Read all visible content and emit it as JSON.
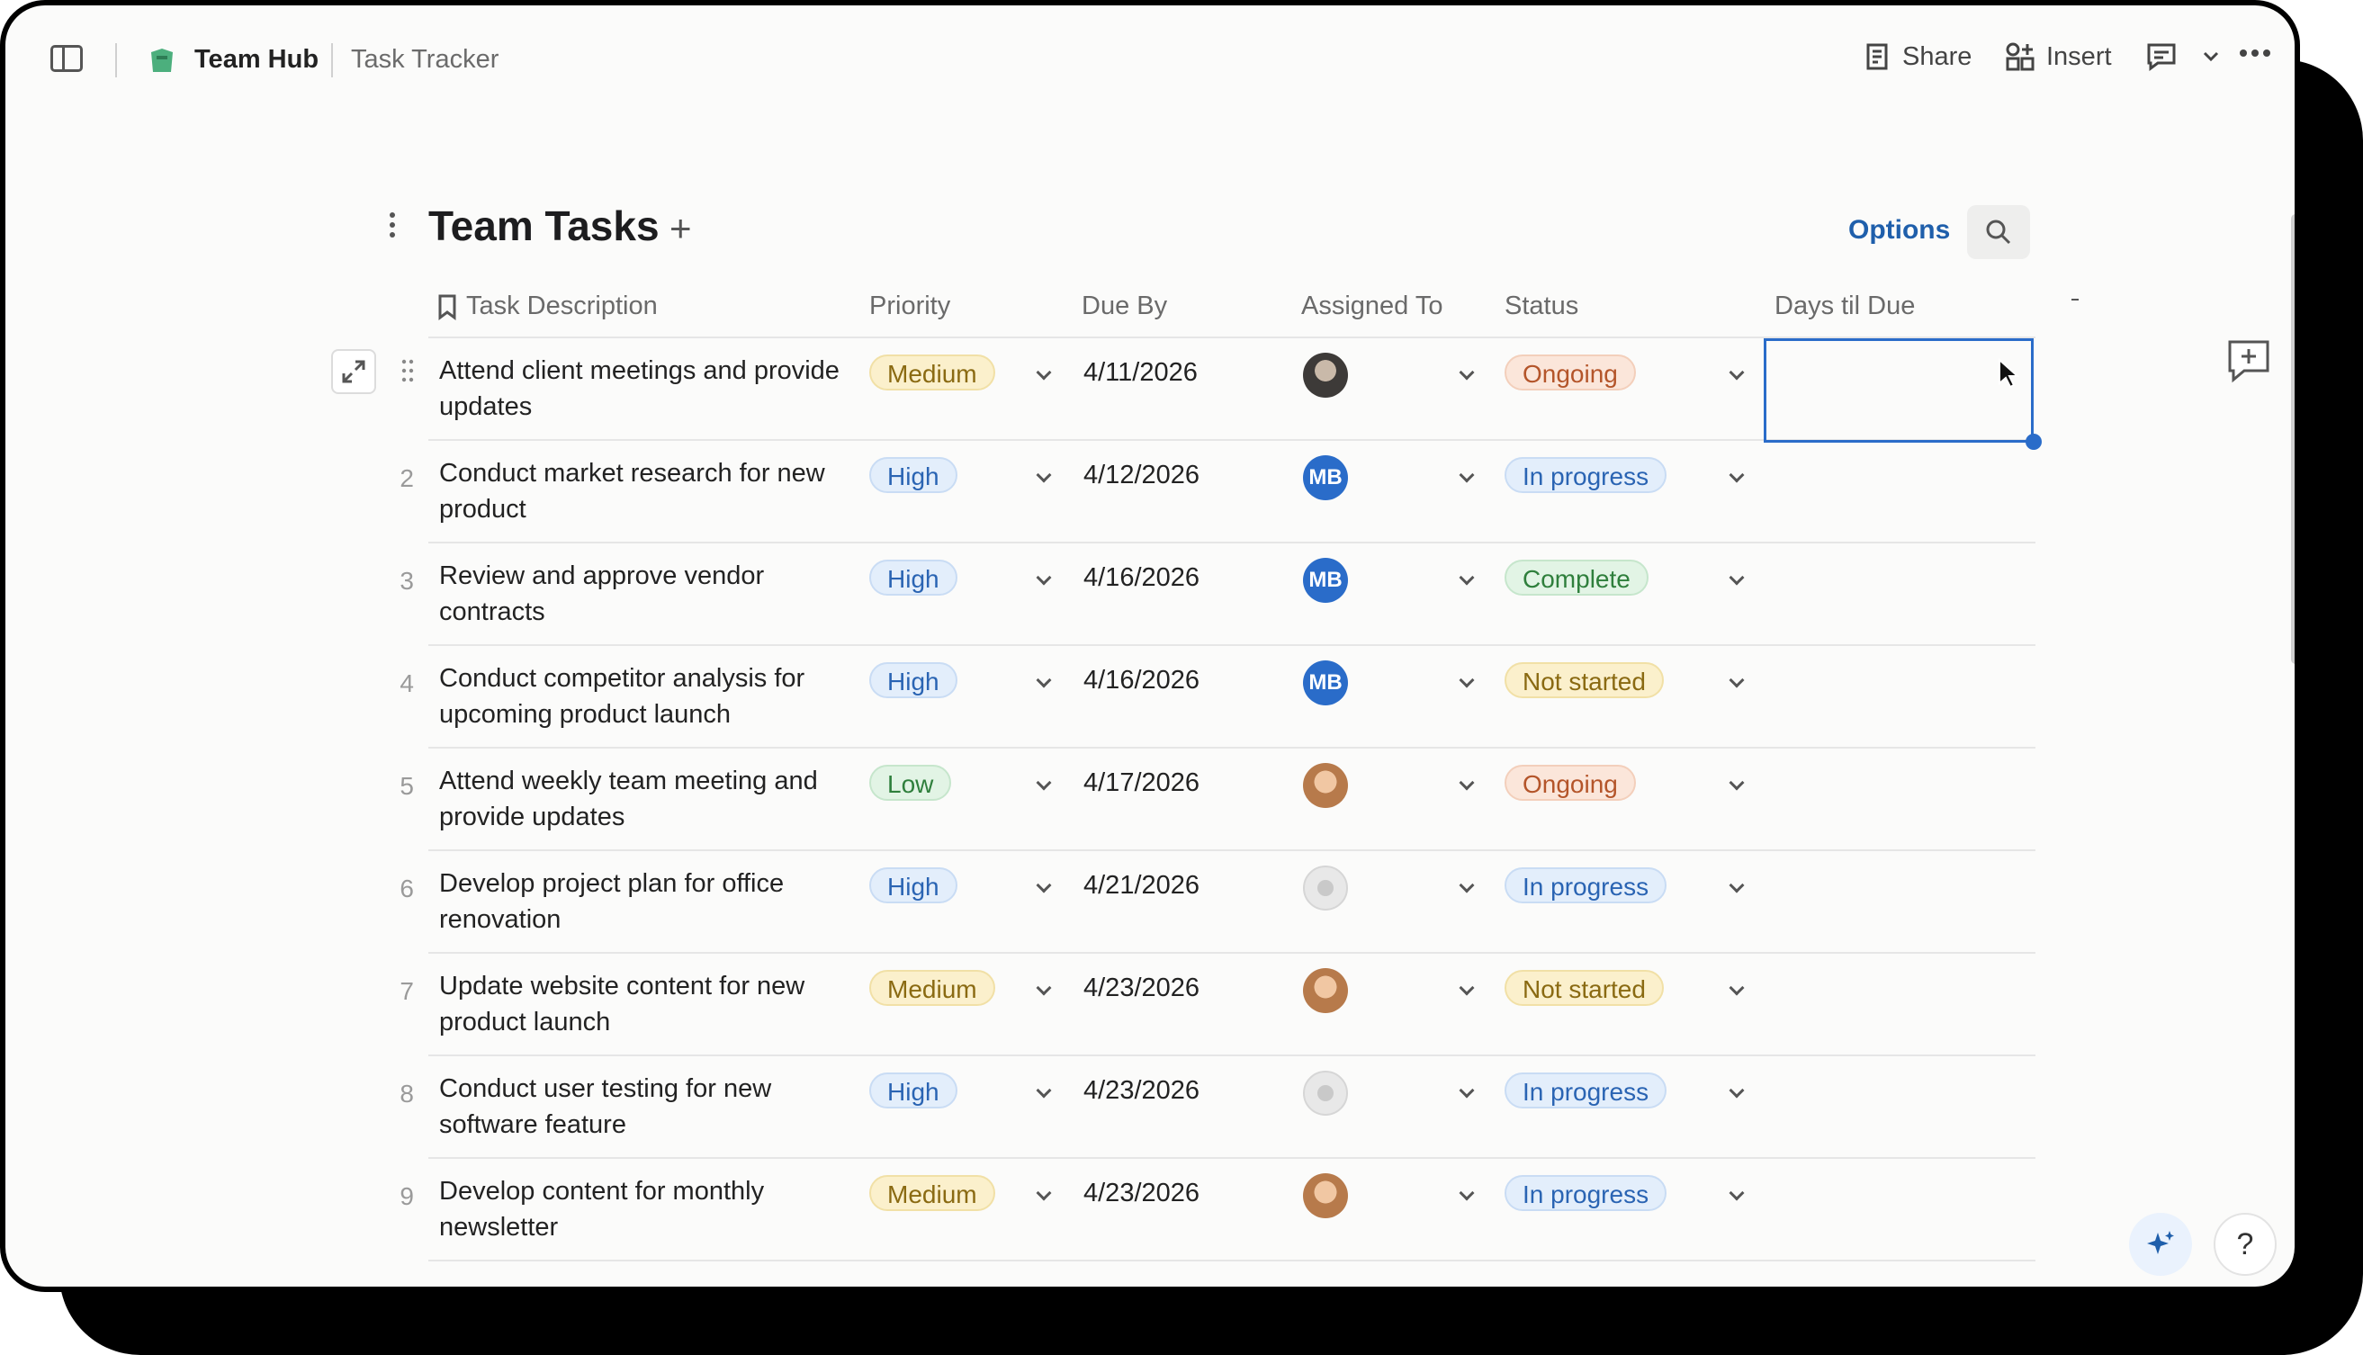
{
  "topbar": {
    "doc_title": "Team Hub",
    "page_title": "Task Tracker",
    "share_label": "Share",
    "insert_label": "Insert"
  },
  "table": {
    "title": "Team Tasks",
    "options_label": "Options",
    "columns": [
      "Task Description",
      "Priority",
      "Due By",
      "Assigned To",
      "Status",
      "Days til Due"
    ],
    "rows": [
      {
        "num": "",
        "desc": "Attend client meetings and provide updates",
        "priority": "Medium",
        "due": "4/11/2026",
        "assignee": "photo-dark",
        "status": "Ongoing"
      },
      {
        "num": "2",
        "desc": "Conduct market research for new product",
        "priority": "High",
        "due": "4/12/2026",
        "assignee": "MB",
        "status": "In progress"
      },
      {
        "num": "3",
        "desc": "Review and approve vendor contracts",
        "priority": "High",
        "due": "4/16/2026",
        "assignee": "MB",
        "status": "Complete"
      },
      {
        "num": "4",
        "desc": "Conduct competitor analysis for upcoming product launch",
        "priority": "High",
        "due": "4/16/2026",
        "assignee": "MB",
        "status": "Not started"
      },
      {
        "num": "5",
        "desc": "Attend weekly team meeting and provide updates",
        "priority": "Low",
        "due": "4/17/2026",
        "assignee": "photo-light",
        "status": "Ongoing"
      },
      {
        "num": "6",
        "desc": "Develop project plan for office renovation",
        "priority": "High",
        "due": "4/21/2026",
        "assignee": "none",
        "status": "In progress"
      },
      {
        "num": "7",
        "desc": "Update website content for new product launch",
        "priority": "Medium",
        "due": "4/23/2026",
        "assignee": "photo-light",
        "status": "Not started"
      },
      {
        "num": "8",
        "desc": "Conduct user testing for new software feature",
        "priority": "High",
        "due": "4/23/2026",
        "assignee": "none",
        "status": "In progress"
      },
      {
        "num": "9",
        "desc": "Develop content for monthly newsletter",
        "priority": "Medium",
        "due": "4/23/2026",
        "assignee": "photo-light",
        "status": "In progress"
      }
    ]
  },
  "help_label": "?"
}
